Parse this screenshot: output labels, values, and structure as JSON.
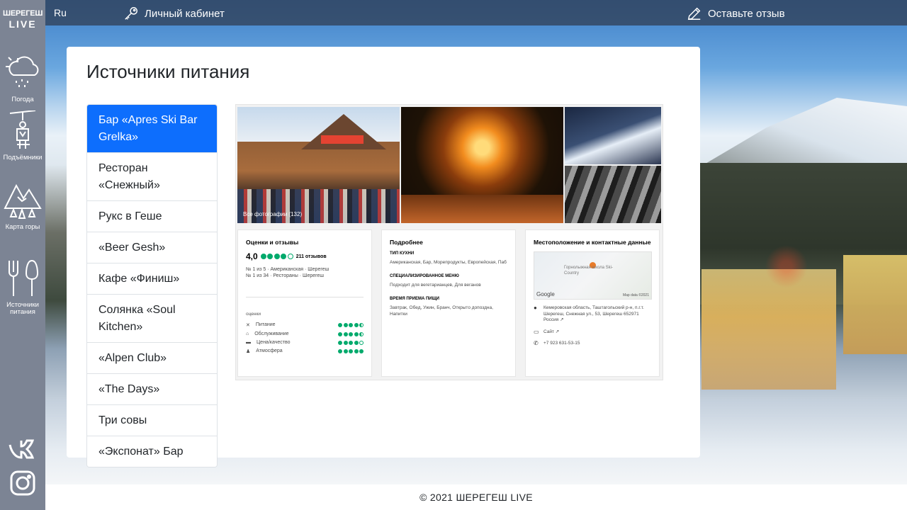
{
  "brand": {
    "line1": "ШЕРЕГЕШ",
    "line2": "LIVE"
  },
  "topbar": {
    "lang": "Ru",
    "cabinet": "Личный кабинет",
    "review": "Оставьте отзыв"
  },
  "sidebar": {
    "items": [
      {
        "label": "Погода",
        "icon": "weather-icon"
      },
      {
        "label": "Подъёмники",
        "icon": "ski-lift-icon"
      },
      {
        "label": "Карта горы",
        "icon": "mountain-map-icon"
      },
      {
        "label": "Источники питания",
        "icon": "food-icon"
      }
    ],
    "social": [
      "vk-icon",
      "instagram-icon"
    ]
  },
  "page": {
    "title": "Источники питания"
  },
  "restaurants": [
    "Бар «Apres Ski Bar Grelka»",
    "Ресторан «Снежный»",
    "Рукс в Геше",
    "«Beer Gesh»",
    "Кафе «Финиш»",
    "Солянка «Soul Kitchen»",
    "«Alpen Club»",
    "«The Days»",
    "Три совы",
    "«Экспонат» Бар"
  ],
  "active_index": 0,
  "venue": {
    "photos_caption": "Все фотографии (132)",
    "ratings": {
      "title": "Оценки и отзывы",
      "score": "4,0",
      "stars": 4,
      "reviews": "211 отзывов",
      "rank1": "№ 1 из 5 · Американская · Шерегеш",
      "rank2": "№ 1 из 34 · Рестораны · Шерегеш",
      "sub_title": "оценки",
      "sub": [
        {
          "icon": "fork-icon",
          "label": "Питание",
          "rating": 4.5
        },
        {
          "icon": "bell-icon",
          "label": "Обслуживание",
          "rating": 4.5
        },
        {
          "icon": "wallet-icon",
          "label": "Цена/качество",
          "rating": 4
        },
        {
          "icon": "person-icon",
          "label": "Атмосфера",
          "rating": 5
        }
      ]
    },
    "details": {
      "title": "Подробнее",
      "cuisine_h": "ТИП КУХНИ",
      "cuisine": "Американская, Бар, Морепродукты, Европейская, Паб",
      "menu_h": "СПЕЦИАЛИЗИРОВАННОЕ МЕНЮ",
      "menu": "Подходит для вегетарианцев, Для веганов",
      "time_h": "ВРЕМЯ ПРИЕМА ПИЩИ",
      "time": "Завтрак, Обед, Ужин, Бранч, Открыто допоздна, Напитки"
    },
    "location": {
      "title": "Местоположение и контактные данные",
      "map_label": "Горнолыжная школа Ski-Country",
      "map_google": "Google",
      "map_data": "Map data ©2021",
      "address": "Кемеровская область, Таштагольский р-н, п.г.т. Шерегеш, Снежная ул., 53, Шерегеш 652971 Россия ↗",
      "site": "Сайт ↗",
      "phone": "+7 923 631-53-15"
    }
  },
  "footer": "© 2021 ШЕРЕГЕШ LIVE",
  "colors": {
    "sidebar": "#7c8494",
    "active": "#0d6efd",
    "rating": "#00aa6c"
  }
}
